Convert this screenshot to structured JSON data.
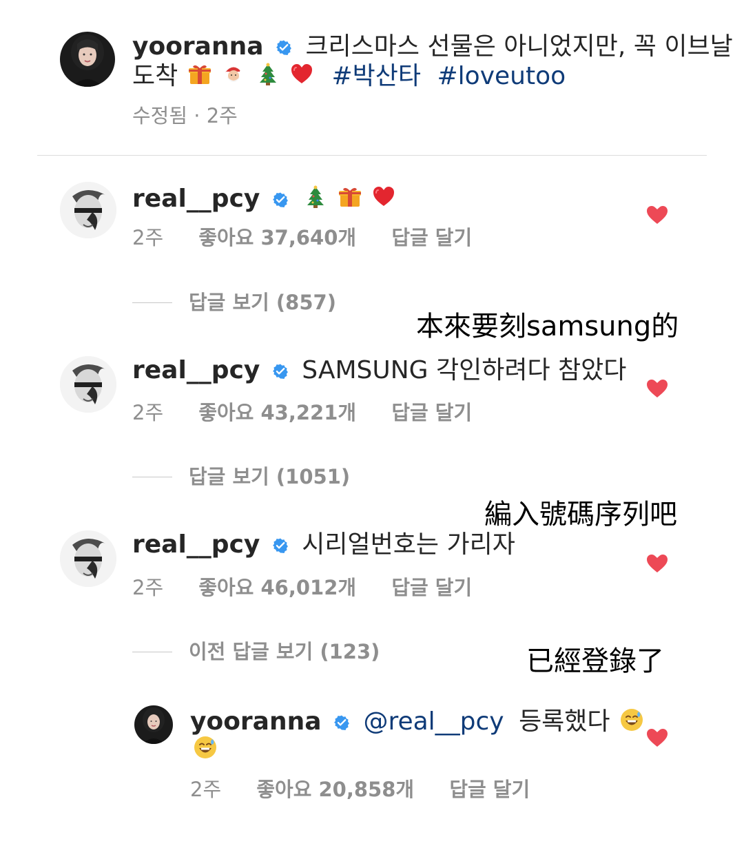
{
  "post": {
    "username": "yooranna",
    "caption_line1": "크리스마스 선물은 아니었지만, 꼭 이브날",
    "caption_line2": "도착",
    "hashtags": [
      "#박산타",
      "#loveutoo"
    ],
    "meta": "수정됨 · 2주"
  },
  "comments": [
    {
      "username": "real__pcy",
      "text": "",
      "time": "2주",
      "likes": "좋아요 37,640개",
      "reply": "답글 달기",
      "view_replies": "답글 보기 (857)"
    },
    {
      "username": "real__pcy",
      "text": "SAMSUNG 각인하려다 참았다",
      "time": "2주",
      "likes": "좋아요 43,221개",
      "reply": "답글 달기",
      "view_replies": "답글 보기 (1051)"
    },
    {
      "username": "real__pcy",
      "text": "시리얼번호는 가리자",
      "time": "2주",
      "likes": "좋아요 46,012개",
      "reply": "답글 달기",
      "view_replies": "이전 답글 보기 (123)"
    }
  ],
  "reply": {
    "username": "yooranna",
    "mention": "@real__pcy",
    "text": "등록했다",
    "time": "2주",
    "likes": "좋아요 20,858개",
    "reply": "답글 달기"
  },
  "annotations": {
    "note1": "本來要刻samsung的",
    "note2": "編入號碼序列吧",
    "note3": "已經登錄了"
  },
  "icons": {
    "verified": "verified-badge-icon",
    "heart": "heart-icon",
    "gift": "gift-emoji",
    "santa": "santa-emoji",
    "tree": "christmas-tree-emoji",
    "red_heart": "red-heart-emoji",
    "sweat_smile": "sweat-smile-emoji"
  },
  "colors": {
    "verified_blue": "#3897f0",
    "heart_red": "#ed4956",
    "hashtag_blue": "#0f3b78",
    "meta_gray": "#8e8e8e",
    "divider": "#dbdbdb"
  }
}
